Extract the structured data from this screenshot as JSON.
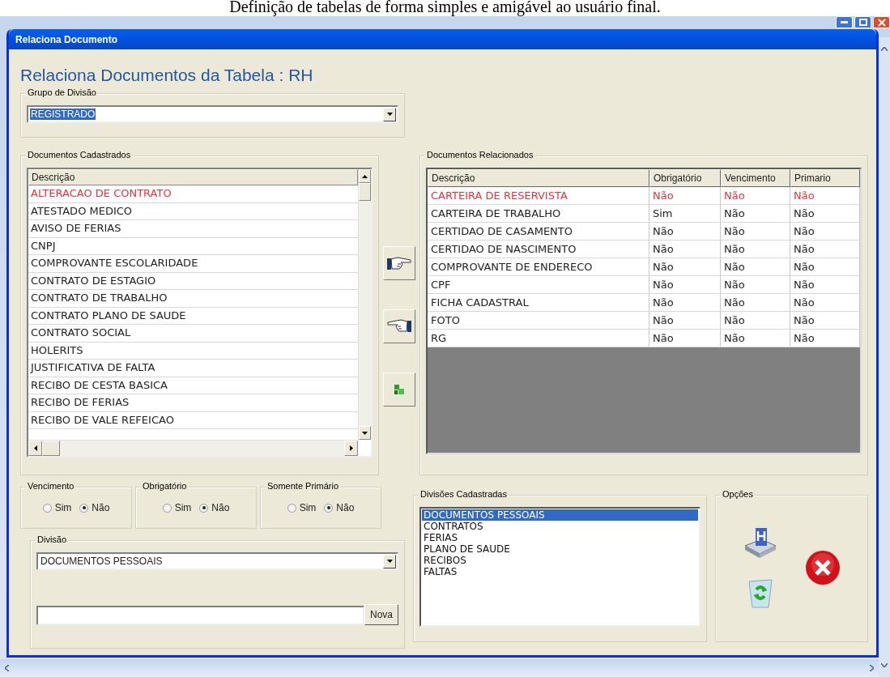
{
  "caption": "Definição de tabelas de forma simples e amigável ao usuário final.",
  "window": {
    "title": "Relaciona Documento"
  },
  "heading": "Relaciona Documentos da Tabela : RH",
  "grupo_divisao": {
    "label": "Grupo de Divisão",
    "value": "REGISTRADO"
  },
  "documentos_cadastrados": {
    "label": "Documentos Cadastrados",
    "column": "Descrição",
    "rows": [
      {
        "text": "ALTERACAO DE CONTRATO",
        "selected": true
      },
      {
        "text": "ATESTADO MEDICO",
        "selected": false
      },
      {
        "text": "AVISO DE FERIAS",
        "selected": false
      },
      {
        "text": "CNPJ",
        "selected": false
      },
      {
        "text": "COMPROVANTE ESCOLARIDADE",
        "selected": false
      },
      {
        "text": "CONTRATO DE ESTAGIO",
        "selected": false
      },
      {
        "text": "CONTRATO DE TRABALHO",
        "selected": false
      },
      {
        "text": "CONTRATO PLANO DE SAUDE",
        "selected": false
      },
      {
        "text": "CONTRATO SOCIAL",
        "selected": false
      },
      {
        "text": "HOLERITS",
        "selected": false
      },
      {
        "text": "JUSTIFICATIVA DE FALTA",
        "selected": false
      },
      {
        "text": "RECIBO DE CESTA BASICA",
        "selected": false
      },
      {
        "text": "RECIBO DE FERIAS",
        "selected": false
      },
      {
        "text": "RECIBO DE VALE REFEICAO",
        "selected": false
      }
    ]
  },
  "documentos_relacionados": {
    "label": "Documentos Relacionados",
    "columns": [
      "Descrição",
      "Obrigatório",
      "Vencimento",
      "Primario"
    ],
    "rows": [
      {
        "cells": [
          "CARTEIRA DE RESERVISTA",
          "Não",
          "Não",
          "Não"
        ],
        "selected": true
      },
      {
        "cells": [
          "CARTEIRA DE TRABALHO",
          "Sim",
          "Não",
          "Não"
        ],
        "selected": false
      },
      {
        "cells": [
          "CERTIDAO DE CASAMENTO",
          "Não",
          "Não",
          "Não"
        ],
        "selected": false
      },
      {
        "cells": [
          "CERTIDAO DE NASCIMENTO",
          "Não",
          "Não",
          "Não"
        ],
        "selected": false
      },
      {
        "cells": [
          "COMPROVANTE DE ENDERECO",
          "Não",
          "Não",
          "Não"
        ],
        "selected": false
      },
      {
        "cells": [
          "CPF",
          "Não",
          "Não",
          "Não"
        ],
        "selected": false
      },
      {
        "cells": [
          "FICHA CADASTRAL",
          "Não",
          "Não",
          "Não"
        ],
        "selected": false
      },
      {
        "cells": [
          "FOTO",
          "Não",
          "Não",
          "Não"
        ],
        "selected": false
      },
      {
        "cells": [
          "RG",
          "Não",
          "Não",
          "Não"
        ],
        "selected": false
      }
    ]
  },
  "radio_groups": [
    {
      "label": "Vencimento",
      "options": [
        {
          "label": "Sim",
          "selected": false
        },
        {
          "label": "Não",
          "selected": true
        }
      ]
    },
    {
      "label": "Obrigatório",
      "options": [
        {
          "label": "Sim",
          "selected": false
        },
        {
          "label": "Não",
          "selected": true
        }
      ]
    },
    {
      "label": "Somente Primário",
      "options": [
        {
          "label": "Sim",
          "selected": false
        },
        {
          "label": "Não",
          "selected": true
        }
      ]
    }
  ],
  "divisao": {
    "label": "Divisão",
    "value": "DOCUMENTOS PESSOAIS",
    "new_button": "Nova"
  },
  "divisoes_cadastradas": {
    "label": "Divisões Cadastradas",
    "items": [
      {
        "text": "DOCUMENTOS PESSOAIS",
        "selected": true
      },
      {
        "text": "CONTRATOS",
        "selected": false
      },
      {
        "text": "FERIAS",
        "selected": false
      },
      {
        "text": "PLANO DE SAUDE",
        "selected": false
      },
      {
        "text": "RECIBOS",
        "selected": false
      },
      {
        "text": "FALTAS",
        "selected": false
      }
    ]
  },
  "opcoes": {
    "label": "Opções"
  }
}
